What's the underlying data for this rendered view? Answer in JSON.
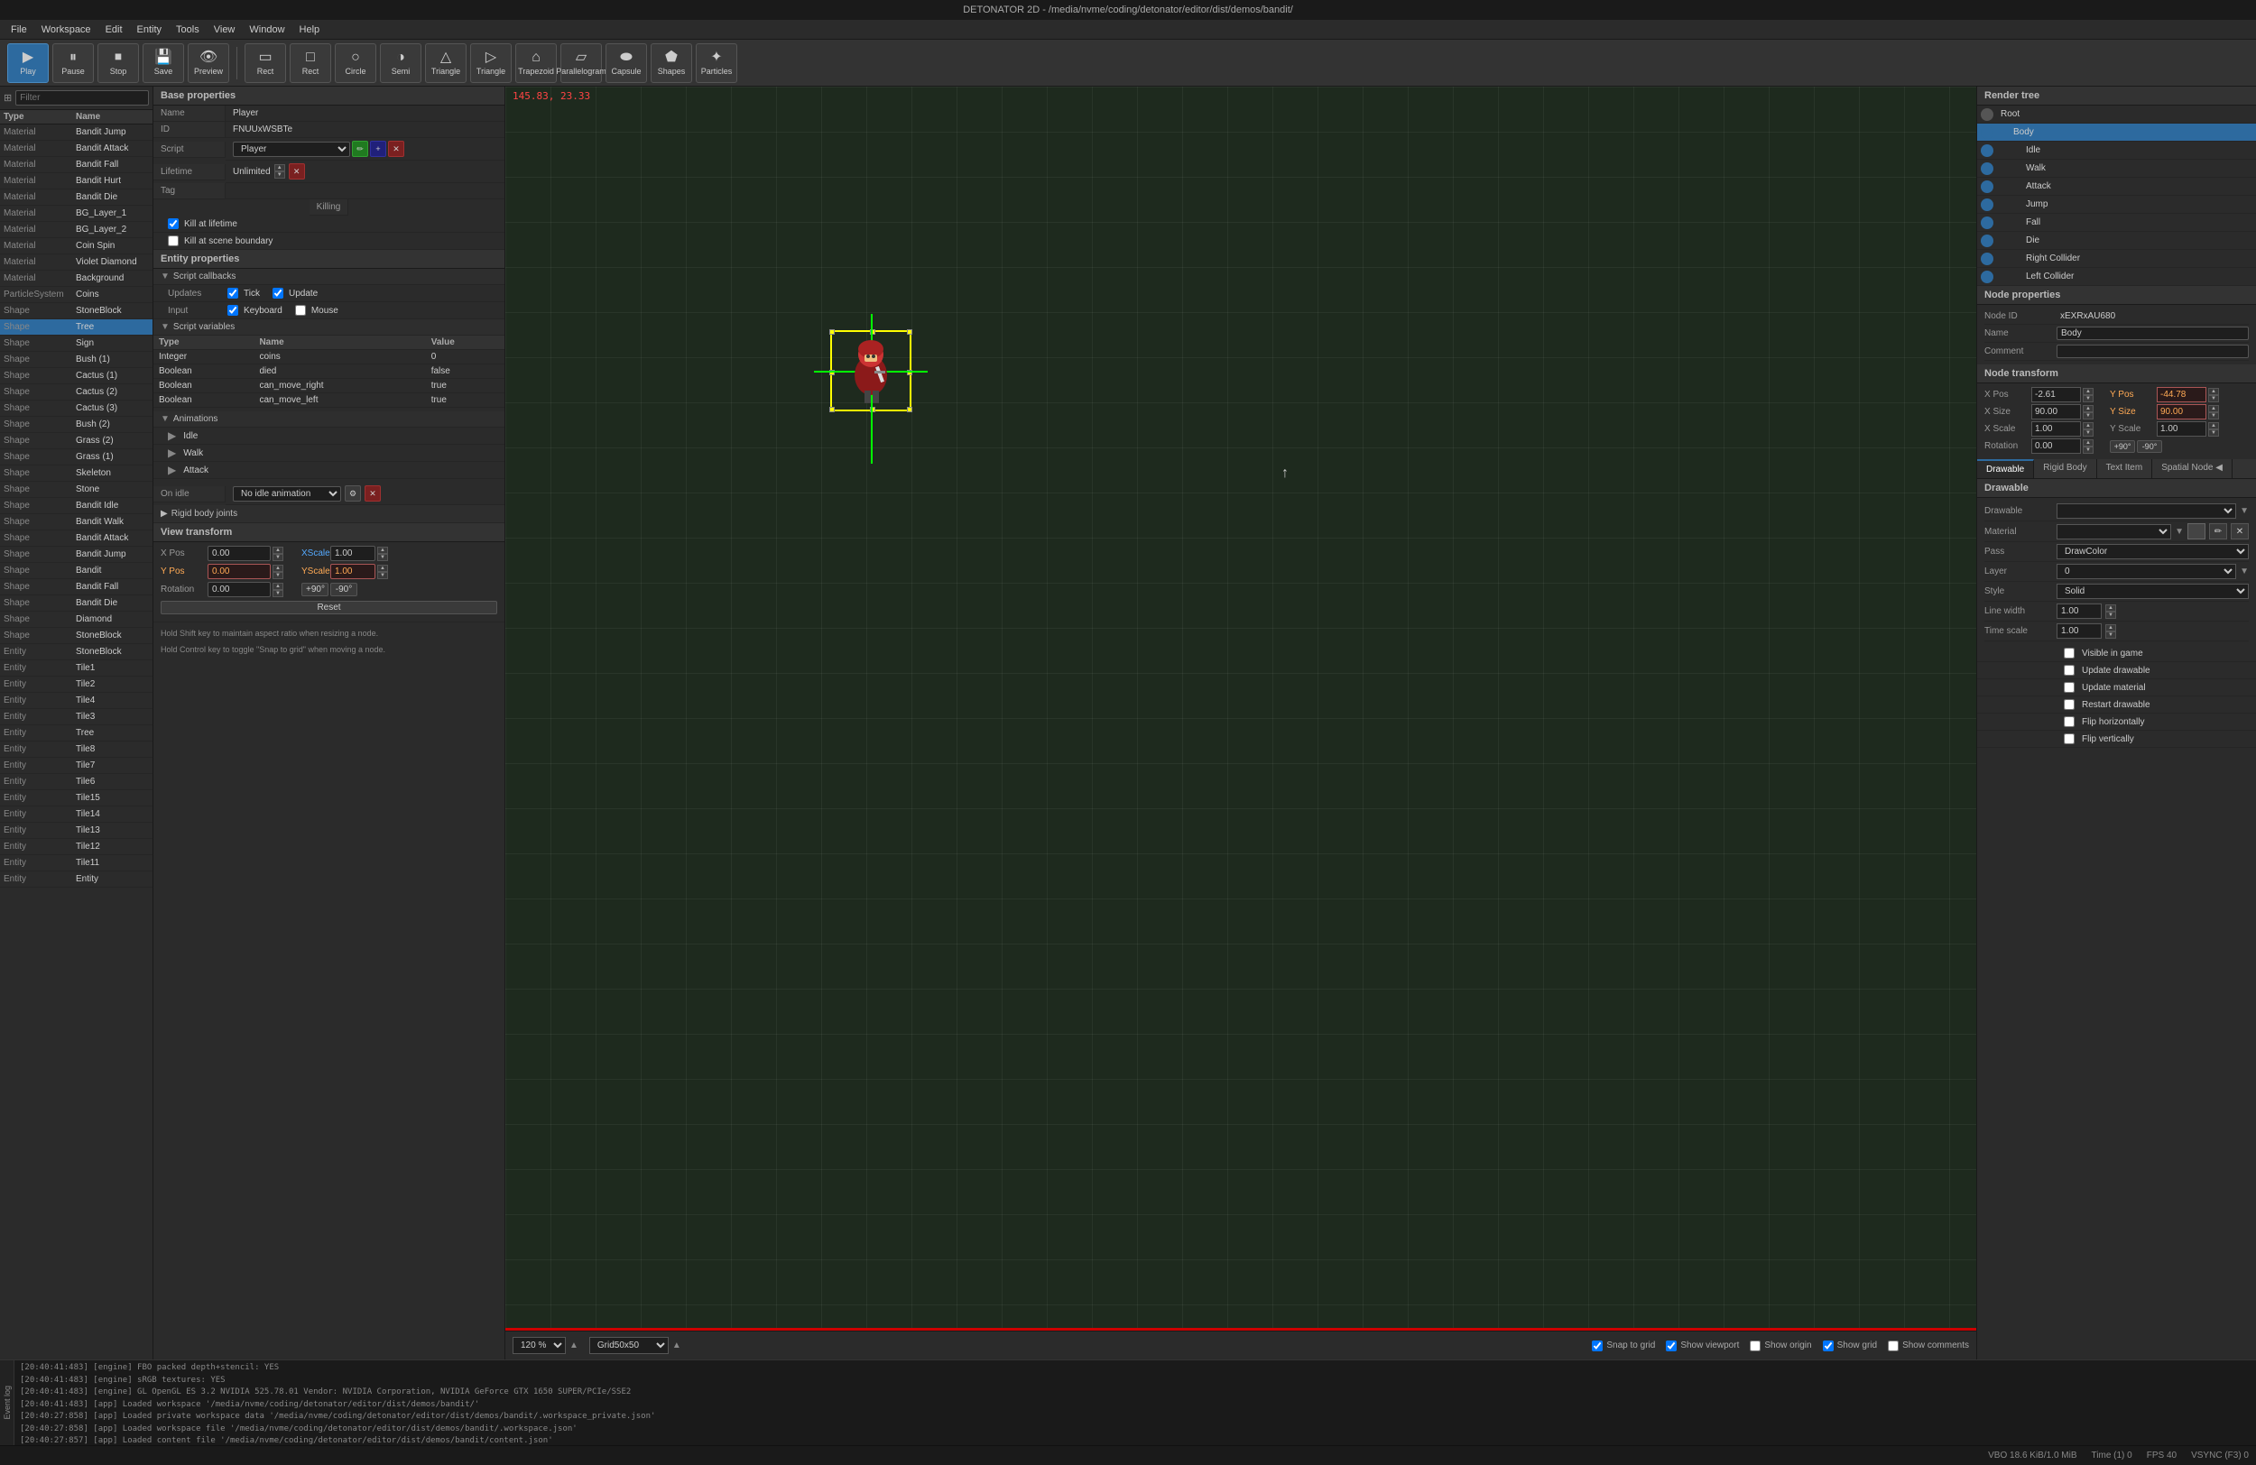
{
  "titlebar": {
    "title": "DETONATOR 2D - /media/nvme/coding/detonator/editor/dist/demos/bandit/"
  },
  "menubar": {
    "items": [
      "File",
      "Workspace",
      "Edit",
      "Entity",
      "Tools",
      "View",
      "Window",
      "Help"
    ]
  },
  "toolbar": {
    "buttons": [
      {
        "label": "Play",
        "icon": "▶",
        "name": "play-btn"
      },
      {
        "label": "Pause",
        "icon": "⏸",
        "name": "pause-btn"
      },
      {
        "label": "Stop",
        "icon": "⏹",
        "name": "stop-btn"
      },
      {
        "label": "Save",
        "icon": "💾",
        "name": "save-btn"
      },
      {
        "label": "Preview",
        "icon": "👁",
        "name": "preview-btn"
      },
      {
        "label": "Rect",
        "icon": "▭",
        "name": "rect-btn"
      },
      {
        "label": "Rect",
        "icon": "□",
        "name": "rect2-btn"
      },
      {
        "label": "Circle",
        "icon": "○",
        "name": "circle-btn"
      },
      {
        "label": "Semi",
        "icon": "◑",
        "name": "semi-btn"
      },
      {
        "label": "Triangle",
        "icon": "△",
        "name": "triangle-btn"
      },
      {
        "label": "Triangle",
        "icon": "◸",
        "name": "triangle2-btn"
      },
      {
        "label": "Trapezoid",
        "icon": "⬡",
        "name": "trapezoid-btn"
      },
      {
        "label": "Parallelogram",
        "icon": "▱",
        "name": "parallelogram-btn"
      },
      {
        "label": "Capsule",
        "icon": "⬬",
        "name": "capsule-btn"
      },
      {
        "label": "Shapes",
        "icon": "⬟",
        "name": "shapes-btn"
      },
      {
        "label": "Particles",
        "icon": "✦",
        "name": "particles-btn"
      }
    ]
  },
  "left_panel": {
    "filter_placeholder": "Filter",
    "header": {
      "type": "Type",
      "name": "Name"
    },
    "assets": [
      {
        "type": "Material",
        "name": "Bandit Jump"
      },
      {
        "type": "Material",
        "name": "Bandit Attack"
      },
      {
        "type": "Material",
        "name": "Bandit Fall"
      },
      {
        "type": "Material",
        "name": "Bandit Hurt"
      },
      {
        "type": "Material",
        "name": "Bandit Die"
      },
      {
        "type": "Material",
        "name": "BG_Layer_1"
      },
      {
        "type": "Material",
        "name": "BG_Layer_2"
      },
      {
        "type": "Material",
        "name": "Coin Spin"
      },
      {
        "type": "Material",
        "name": "Violet Diamond"
      },
      {
        "type": "Material",
        "name": "Background"
      },
      {
        "type": "ParticleSystem",
        "name": "Coins"
      },
      {
        "type": "Shape",
        "name": "StoneBlock"
      },
      {
        "type": "Shape",
        "name": "Tree"
      },
      {
        "type": "Shape",
        "name": "Sign"
      },
      {
        "type": "Shape",
        "name": "Bush (1)"
      },
      {
        "type": "Shape",
        "name": "Cactus (1)"
      },
      {
        "type": "Shape",
        "name": "Cactus (2)"
      },
      {
        "type": "Shape",
        "name": "Cactus (3)"
      },
      {
        "type": "Shape",
        "name": "Bush (2)"
      },
      {
        "type": "Shape",
        "name": "Grass (2)"
      },
      {
        "type": "Shape",
        "name": "Grass (1)"
      },
      {
        "type": "Shape",
        "name": "Skeleton"
      },
      {
        "type": "Shape",
        "name": "Stone"
      },
      {
        "type": "Shape",
        "name": "Bandit Idle"
      },
      {
        "type": "Shape",
        "name": "Bandit Walk"
      },
      {
        "type": "Shape",
        "name": "Bandit Attack"
      },
      {
        "type": "Shape",
        "name": "Bandit Jump"
      },
      {
        "type": "Shape",
        "name": "Bandit"
      },
      {
        "type": "Shape",
        "name": "Bandit Fall"
      },
      {
        "type": "Shape",
        "name": "Bandit Die"
      },
      {
        "type": "Shape",
        "name": "Diamond"
      },
      {
        "type": "Shape",
        "name": "StoneBlock"
      },
      {
        "type": "Entity",
        "name": "StoneBlock"
      },
      {
        "type": "Entity",
        "name": "Tile1"
      },
      {
        "type": "Entity",
        "name": "Tile2"
      },
      {
        "type": "Entity",
        "name": "Tile4"
      },
      {
        "type": "Entity",
        "name": "Tile3"
      },
      {
        "type": "Entity",
        "name": "Tree"
      },
      {
        "type": "Entity",
        "name": "Tile8"
      },
      {
        "type": "Entity",
        "name": "Tile7"
      },
      {
        "type": "Entity",
        "name": "Tile6"
      },
      {
        "type": "Entity",
        "name": "Tile15"
      },
      {
        "type": "Entity",
        "name": "Tile14"
      },
      {
        "type": "Entity",
        "name": "Tile13"
      },
      {
        "type": "Entity",
        "name": "Tile12"
      },
      {
        "type": "Entity",
        "name": "Tile11"
      },
      {
        "type": "Entity",
        "name": "Entity"
      }
    ]
  },
  "base_properties": {
    "header": "Base properties",
    "name_label": "Name",
    "name_value": "Player",
    "id_label": "ID",
    "id_value": "FNUUxWSBTe",
    "script_label": "Script",
    "script_value": "Player",
    "lifetime_label": "Lifetime",
    "lifetime_value": "Unlimited",
    "tag_label": "Tag",
    "killing_label": "Killing",
    "kill_at_lifetime": "Kill at lifetime",
    "kill_at_boundary": "Kill at scene boundary"
  },
  "entity_properties": {
    "header": "Entity properties",
    "script_callbacks_label": "Script callbacks",
    "updates_label": "Updates",
    "tick_label": "Tick",
    "update_label": "Update",
    "input_label": "Input",
    "keyboard_label": "Keyboard",
    "mouse_label": "Mouse",
    "script_variables_label": "Script variables",
    "variables": [
      {
        "type": "Integer",
        "name": "coins",
        "value": "0"
      },
      {
        "type": "Boolean",
        "name": "died",
        "value": "false"
      },
      {
        "type": "Boolean",
        "name": "can_move_right",
        "value": "true"
      },
      {
        "type": "Boolean",
        "name": "can_move_left",
        "value": "true"
      }
    ]
  },
  "animations": {
    "header": "Animations",
    "items": [
      "Idle",
      "Walk",
      "Attack"
    ],
    "on_idle_label": "On idle",
    "on_idle_value": "No idle animation",
    "rigid_body_joints": "Rigid body joints"
  },
  "view_transform": {
    "header": "View transform",
    "x_pos_label": "X Pos",
    "x_pos_value": "0.00",
    "x_scale_label": "XScale",
    "x_scale_value": "1.00",
    "y_pos_label": "Y Pos",
    "y_pos_value": "0.00",
    "y_scale_label": "YScale",
    "y_scale_value": "1.00",
    "rotation_label": "Rotation",
    "rotation_value": "0.00",
    "plus90": "+90°",
    "minus90": "-90°",
    "reset_btn": "Reset",
    "hint1": "Hold Shift key to maintain aspect ratio when resizing a node.",
    "hint2": "Hold Control key to toggle \"Snap to grid\" when moving a node."
  },
  "viewport": {
    "coords": "145.83, 23.33",
    "zoom": "120 %",
    "grid": "Grid50x50",
    "snap_to_grid": "Snap to grid",
    "show_viewport": "Show viewport",
    "show_origin": "Show origin",
    "show_grid": "Show grid",
    "show_comments": "Show comments"
  },
  "render_tree": {
    "header": "Render tree",
    "items": [
      {
        "label": "Root",
        "indent": 0,
        "visible": false
      },
      {
        "label": "Body",
        "indent": 1,
        "visible": true,
        "selected": true
      },
      {
        "label": "Idle",
        "indent": 2,
        "visible": true
      },
      {
        "label": "Walk",
        "indent": 2,
        "visible": true
      },
      {
        "label": "Attack",
        "indent": 2,
        "visible": true
      },
      {
        "label": "Jump",
        "indent": 2,
        "visible": true
      },
      {
        "label": "Fall",
        "indent": 2,
        "visible": true
      },
      {
        "label": "Die",
        "indent": 2,
        "visible": true
      },
      {
        "label": "Right Collider",
        "indent": 2,
        "visible": true
      },
      {
        "label": "Left Collider",
        "indent": 2,
        "visible": true
      }
    ]
  },
  "node_properties": {
    "header": "Node properties",
    "node_id_label": "Node ID",
    "node_id_value": "xEXRxAU680",
    "name_label": "Name",
    "name_value": "Body",
    "comment_label": "Comment",
    "comment_value": ""
  },
  "node_transform": {
    "header": "Node transform",
    "x_pos_label": "X Pos",
    "x_pos_value": "-2.61",
    "y_pos_label": "Y Pos",
    "y_pos_value": "-44.78",
    "x_size_label": "X Size",
    "x_size_value": "90.00",
    "y_size_label": "Y Size",
    "y_size_value": "90.00",
    "x_scale_label": "X Scale",
    "x_scale_value": "1.00",
    "y_scale_label": "Y Scale",
    "y_scale_value": "1.00",
    "rotation_label": "Rotation",
    "rotation_value": "0.00",
    "plus90": "+90°",
    "minus90": "-90°"
  },
  "right_tabs": {
    "tabs": [
      "Drawable",
      "Rigid Body",
      "Text Item",
      "Spatial Node ◀"
    ]
  },
  "drawable_section": {
    "header": "Drawable",
    "drawable_label": "Drawable",
    "drawable_value": "",
    "material_label": "Material",
    "material_value": "",
    "pass_label": "Pass",
    "pass_value": "DrawColor",
    "layer_label": "Layer",
    "layer_value": "0",
    "style_label": "Style",
    "style_value": "Solid",
    "line_width_label": "Line width",
    "line_width_value": "1.00",
    "time_scale_label": "Time scale",
    "time_scale_value": "1.00",
    "checks": [
      {
        "label": "Visible in game",
        "checked": false
      },
      {
        "label": "Update drawable",
        "checked": false
      },
      {
        "label": "Update material",
        "checked": false
      },
      {
        "label": "Restart drawable",
        "checked": false
      },
      {
        "label": "Flip horizontally",
        "checked": false
      },
      {
        "label": "Flip vertically",
        "checked": false
      }
    ]
  },
  "statusbar": {
    "vbo": "VBO 18.6 KiB/1.0 MiB",
    "time": "Time (1) 0",
    "fps": "FPS 40",
    "vsync": "VSYNC (F3) 0"
  },
  "log": {
    "lines": [
      "[20:40:41:483] [engine] FBO packed depth+stencil: YES",
      "[20:40:41:483] [engine] sRGB textures: YES",
      "[20:40:41:483] [engine] GL OpenGL ES 3.2 NVIDIA 525.78.01 Vendor: NVIDIA Corporation, NVIDIA GeForce GTX 1650 SUPER/PCIe/SSE2",
      "[20:40:41:483] [app] Loaded workspace '/media/nvme/coding/detonator/editor/dist/demos/bandit/'",
      "[20:40:27:858] [app] Loaded private workspace data '/media/nvme/coding/detonator/editor/dist/demos/bandit/.workspace_private.json'",
      "[20:40:27:858] [app] Loaded workspace file '/media/nvme/coding/detonator/editor/dist/demos/bandit/.workspace.json'",
      "[20:40:27:857] [app] Loaded content file '/media/nvme/coding/detonator/editor/dist/demos/bandit/content.json'"
    ]
  }
}
